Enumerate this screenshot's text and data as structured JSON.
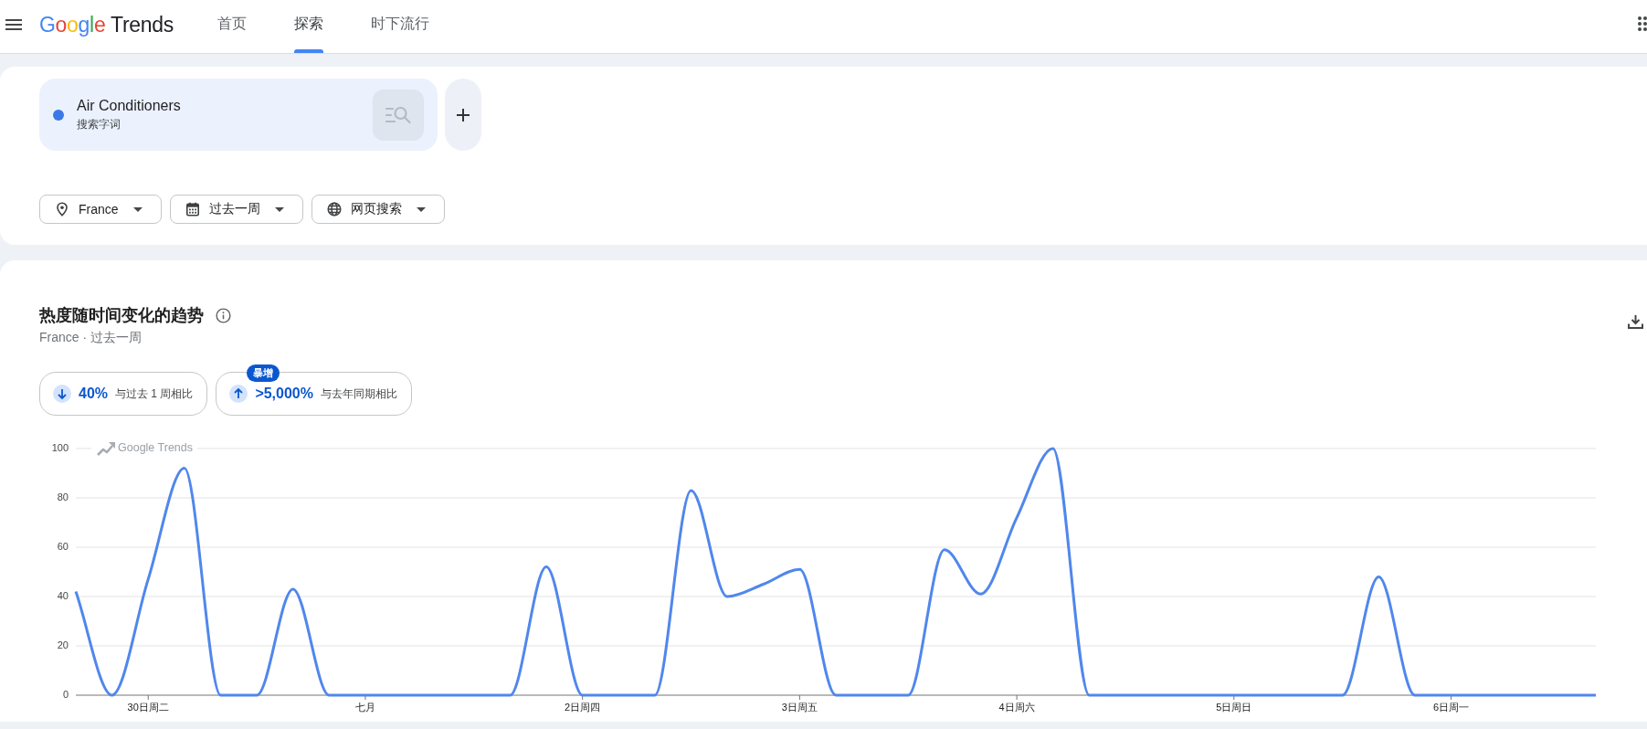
{
  "header": {
    "logo": {
      "brand": "Google",
      "product": "Trends"
    },
    "tabs": [
      {
        "label": "首页",
        "selected": false
      },
      {
        "label": "探索",
        "selected": true
      },
      {
        "label": "时下流行",
        "selected": false
      }
    ]
  },
  "search": {
    "terms": [
      {
        "label": "Air Conditioners",
        "type": "搜索字词",
        "color": "#3b78e7"
      }
    ],
    "filters": [
      {
        "kind": "location",
        "label": "France"
      },
      {
        "kind": "time",
        "label": "过去一周"
      },
      {
        "kind": "property",
        "label": "网页搜索"
      }
    ]
  },
  "interest_over_time": {
    "title": "热度随时间变化的趋势",
    "subtitle": "France · 过去一周",
    "comparisons": [
      {
        "kind": "decrease",
        "value": "40%",
        "label": "与过去 1 周相比"
      },
      {
        "kind": "increase",
        "value": ">5,000%",
        "label": "与去年同期相比",
        "tag": "暴增"
      }
    ],
    "chart_logo": "Google Trends",
    "chart_data": {
      "type": "line",
      "categories": [
        null,
        null,
        "30日周二",
        null,
        null,
        null,
        null,
        null,
        "七月",
        null,
        null,
        null,
        null,
        null,
        "2日周四",
        null,
        null,
        null,
        null,
        null,
        "3日周五",
        null,
        null,
        null,
        null,
        null,
        "4日周六",
        null,
        null,
        null,
        null,
        null,
        "5日周日",
        null,
        null,
        null,
        null,
        null,
        "6日周一",
        null,
        null,
        null,
        null
      ],
      "series": [
        {
          "color": "#5087ec",
          "values": [
            42,
            0,
            47,
            92,
            0,
            0,
            43,
            0,
            0,
            0,
            0,
            0,
            0,
            52,
            0,
            0,
            0,
            83,
            40,
            45,
            51,
            0,
            0,
            0,
            59,
            41,
            72,
            100,
            0,
            0,
            0,
            0,
            0,
            0,
            0,
            0,
            48,
            0,
            0,
            0,
            0,
            0,
            0
          ]
        }
      ],
      "ylim": [
        0,
        100
      ],
      "yticks": [
        0,
        20,
        40,
        60,
        80,
        100
      ],
      "grid": true
    }
  }
}
